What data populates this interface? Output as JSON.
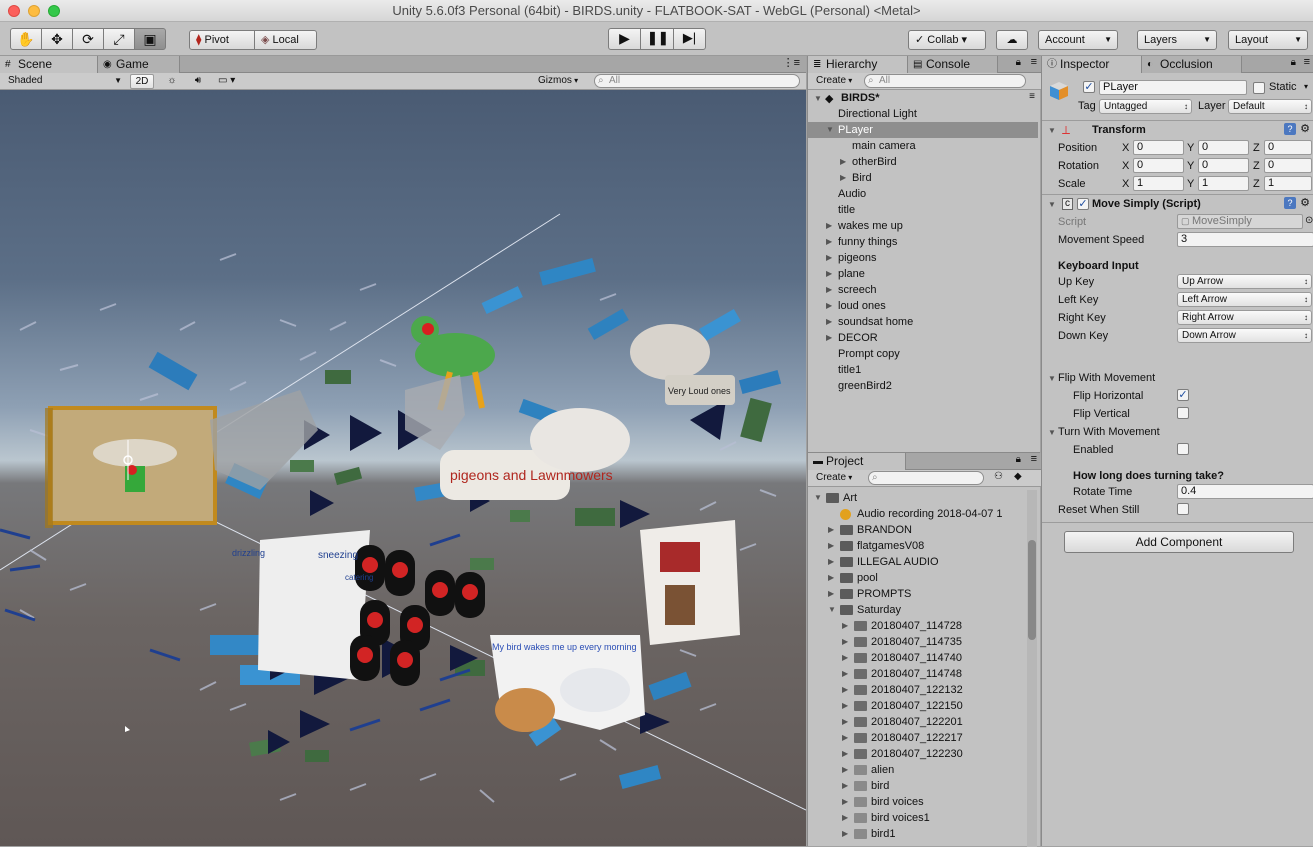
{
  "window": {
    "title": "Unity 5.6.0f3 Personal (64bit) - BIRDS.unity - FLATBOOK-SAT - WebGL (Personal) <Metal>"
  },
  "toolbar": {
    "tools": [
      "hand-icon",
      "move-icon",
      "rotate-icon",
      "scale-icon",
      "rect-icon"
    ],
    "pivot_label": "Pivot",
    "local_label": "Local",
    "collab_label": "Collab ▾",
    "account_label": "Account",
    "layers_label": "Layers",
    "layout_label": "Layout"
  },
  "scene": {
    "tab_scene": "Scene",
    "tab_game": "Game",
    "shading": "Shaded",
    "mode_2d": "2D",
    "gizmos_label": "Gizmos",
    "search_placeholder": "All",
    "art_texts": [
      "pigeons and Lawnmowers",
      "Very Loud ones",
      "My bird wakes me up every morning",
      "sneezing",
      "drizzling",
      "catering"
    ]
  },
  "hierarchy": {
    "tab": "Hierarchy",
    "console_tab": "Console",
    "create_label": "Create",
    "search_placeholder": "All",
    "scene_name": "BIRDS*",
    "items": [
      {
        "label": "Directional Light",
        "indent": 1,
        "expand": "none"
      },
      {
        "label": "PLayer",
        "indent": 1,
        "expand": "open",
        "selected": true
      },
      {
        "label": "main camera",
        "indent": 2,
        "expand": "none"
      },
      {
        "label": "otherBird",
        "indent": 2,
        "expand": "closed"
      },
      {
        "label": "Bird",
        "indent": 2,
        "expand": "closed"
      },
      {
        "label": "Audio",
        "indent": 1,
        "expand": "none"
      },
      {
        "label": "title",
        "indent": 1,
        "expand": "none"
      },
      {
        "label": "wakes me up",
        "indent": 1,
        "expand": "closed"
      },
      {
        "label": "funny things",
        "indent": 1,
        "expand": "closed"
      },
      {
        "label": "pigeons",
        "indent": 1,
        "expand": "closed"
      },
      {
        "label": "plane",
        "indent": 1,
        "expand": "closed"
      },
      {
        "label": "screech",
        "indent": 1,
        "expand": "closed"
      },
      {
        "label": "loud ones",
        "indent": 1,
        "expand": "closed"
      },
      {
        "label": "soundsat home",
        "indent": 1,
        "expand": "closed"
      },
      {
        "label": "DECOR",
        "indent": 1,
        "expand": "closed"
      },
      {
        "label": "Prompt copy",
        "indent": 1,
        "expand": "none"
      },
      {
        "label": "title1",
        "indent": 1,
        "expand": "none"
      },
      {
        "label": "greenBird2",
        "indent": 1,
        "expand": "none"
      }
    ]
  },
  "project": {
    "tab": "Project",
    "create_label": "Create",
    "items": [
      {
        "label": "Art",
        "indent": 0,
        "expand": "open",
        "icon": "folder"
      },
      {
        "label": "Audio recording 2018-04-07 1",
        "indent": 1,
        "expand": "none",
        "icon": "audio"
      },
      {
        "label": "BRANDON",
        "indent": 1,
        "expand": "closed",
        "icon": "folder"
      },
      {
        "label": "flatgamesV08",
        "indent": 1,
        "expand": "closed",
        "icon": "folder"
      },
      {
        "label": "ILLEGAL AUDIO",
        "indent": 1,
        "expand": "closed",
        "icon": "folder"
      },
      {
        "label": "pool",
        "indent": 1,
        "expand": "closed",
        "icon": "folder"
      },
      {
        "label": "PROMPTS",
        "indent": 1,
        "expand": "closed",
        "icon": "folder"
      },
      {
        "label": "Saturday",
        "indent": 1,
        "expand": "open",
        "icon": "folder"
      },
      {
        "label": "20180407_114728",
        "indent": 2,
        "expand": "closed",
        "icon": "image"
      },
      {
        "label": "20180407_114735",
        "indent": 2,
        "expand": "closed",
        "icon": "image"
      },
      {
        "label": "20180407_114740",
        "indent": 2,
        "expand": "closed",
        "icon": "image"
      },
      {
        "label": "20180407_114748",
        "indent": 2,
        "expand": "closed",
        "icon": "image"
      },
      {
        "label": "20180407_122132",
        "indent": 2,
        "expand": "closed",
        "icon": "image"
      },
      {
        "label": "20180407_122150",
        "indent": 2,
        "expand": "closed",
        "icon": "image"
      },
      {
        "label": "20180407_122201",
        "indent": 2,
        "expand": "closed",
        "icon": "image"
      },
      {
        "label": "20180407_122217",
        "indent": 2,
        "expand": "closed",
        "icon": "image"
      },
      {
        "label": "20180407_122230",
        "indent": 2,
        "expand": "closed",
        "icon": "image"
      },
      {
        "label": "alien",
        "indent": 2,
        "expand": "closed",
        "icon": "sprite"
      },
      {
        "label": "bird",
        "indent": 2,
        "expand": "closed",
        "icon": "sprite"
      },
      {
        "label": "bird voices",
        "indent": 2,
        "expand": "closed",
        "icon": "sprite"
      },
      {
        "label": "bird voices1",
        "indent": 2,
        "expand": "closed",
        "icon": "sprite"
      },
      {
        "label": "bird1",
        "indent": 2,
        "expand": "closed",
        "icon": "sprite"
      }
    ]
  },
  "inspector": {
    "tab": "Inspector",
    "occlusion_tab": "Occlusion",
    "object_name": "PLayer",
    "static_label": "Static",
    "tag_label": "Tag",
    "tag_value": "Untagged",
    "layer_label": "Layer",
    "layer_value": "Default",
    "transform": {
      "title": "Transform",
      "rows": [
        {
          "label": "Position",
          "x": "0",
          "y": "0",
          "z": "0"
        },
        {
          "label": "Rotation",
          "x": "0",
          "y": "0",
          "z": "0"
        },
        {
          "label": "Scale",
          "x": "1",
          "y": "1",
          "z": "1"
        }
      ],
      "axis": {
        "x": "X",
        "y": "Y",
        "z": "Z"
      }
    },
    "script": {
      "title": "Move Simply (Script)",
      "script_label": "Script",
      "script_value": "MoveSimply",
      "speed_label": "Movement Speed",
      "speed_value": "3",
      "keyboard_header": "Keyboard Input",
      "keys": [
        {
          "label": "Up Key",
          "value": "Up Arrow"
        },
        {
          "label": "Left Key",
          "value": "Left Arrow"
        },
        {
          "label": "Right Key",
          "value": "Right Arrow"
        },
        {
          "label": "Down Key",
          "value": "Down Arrow"
        }
      ],
      "flip_header": "Flip With Movement",
      "flip_h_label": "Flip Horizontal",
      "flip_v_label": "Flip Vertical",
      "turn_header": "Turn With Movement",
      "enabled_label": "Enabled",
      "turning_header": "How long does turning take?",
      "rotate_time_label": "Rotate Time",
      "rotate_time_value": "0.4",
      "reset_label": "Reset When Still"
    },
    "add_component_label": "Add Component"
  }
}
